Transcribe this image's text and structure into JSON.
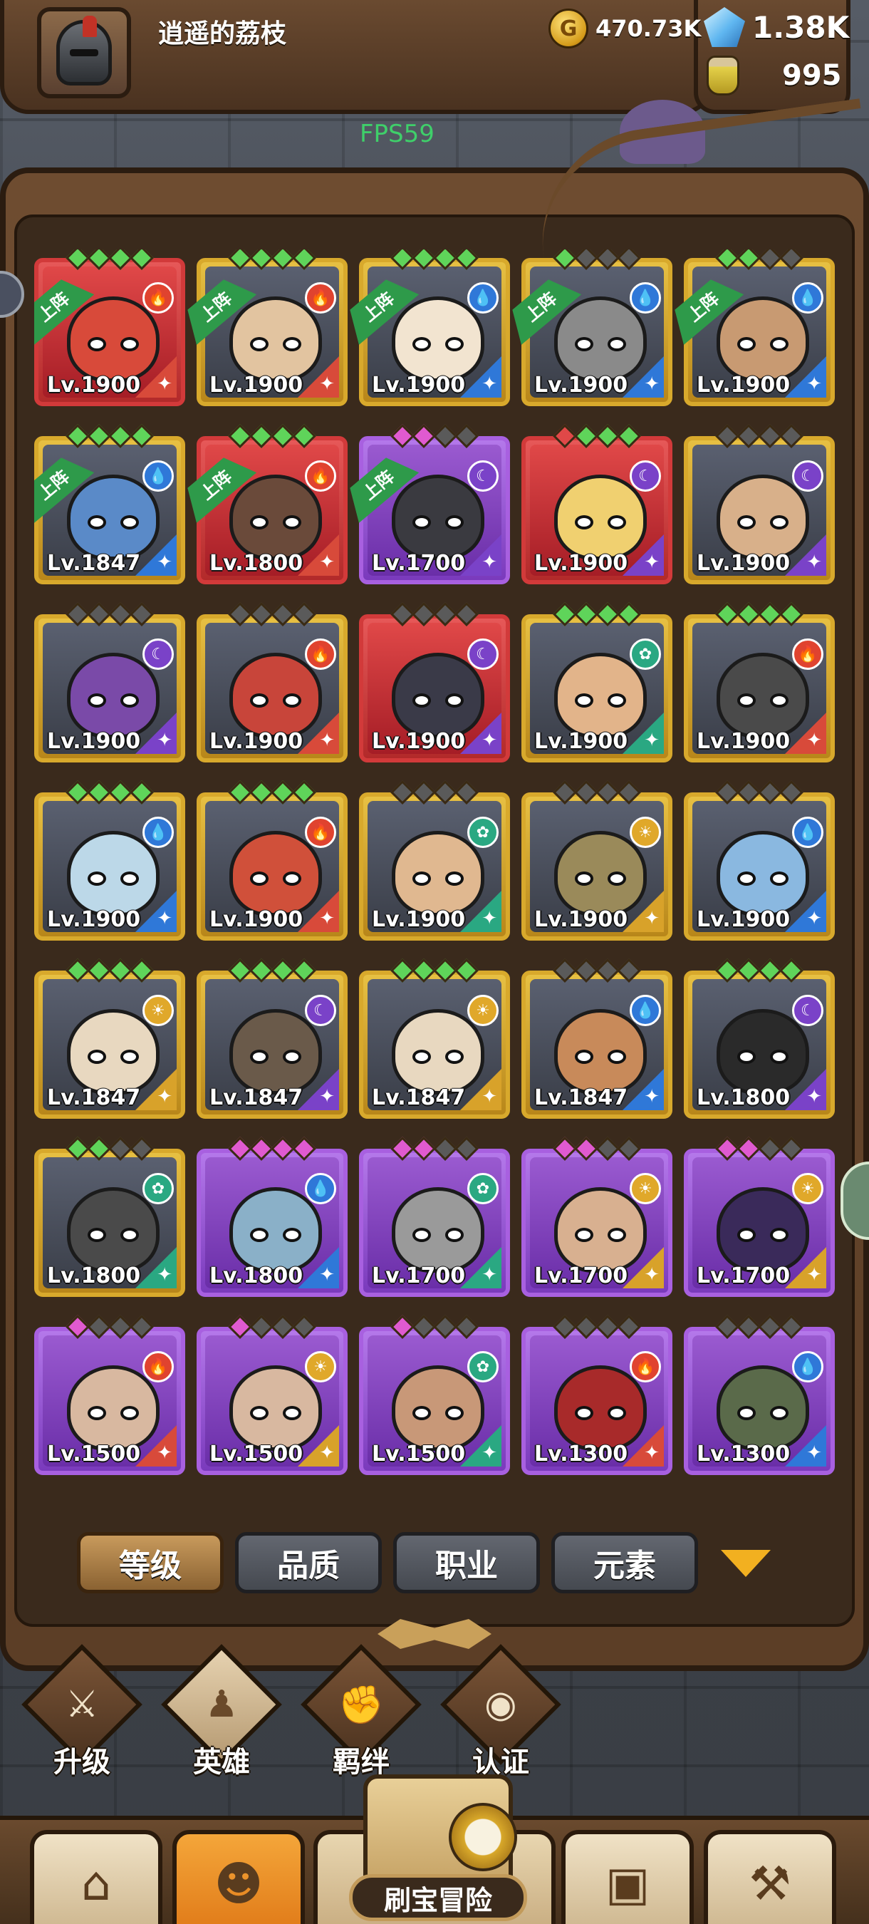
{
  "player": {
    "name": "逍遥的荔枝",
    "gold": "470.73K",
    "gems": "1.38K",
    "potion": "995"
  },
  "fps": "FPS59",
  "onfield_label": "上阵",
  "heroes": [
    {
      "lv": "Lv.1900",
      "onfield": true,
      "element": "fire",
      "rarity": "red",
      "gems": [
        "green",
        "green",
        "green",
        "green"
      ],
      "skin": "#d84a3a"
    },
    {
      "lv": "Lv.1900",
      "onfield": true,
      "element": "fire",
      "rarity": "gold",
      "gems": [
        "green",
        "green",
        "green",
        "green"
      ],
      "skin": "#e2c4a0"
    },
    {
      "lv": "Lv.1900",
      "onfield": true,
      "element": "water",
      "rarity": "gold",
      "gems": [
        "green",
        "green",
        "green",
        "green"
      ],
      "skin": "#f2e4d0"
    },
    {
      "lv": "Lv.1900",
      "onfield": true,
      "element": "water",
      "rarity": "gold",
      "gems": [
        "green",
        "gray",
        "gray",
        "gray"
      ],
      "skin": "#8a8a8a"
    },
    {
      "lv": "Lv.1900",
      "onfield": true,
      "element": "water",
      "rarity": "gold",
      "gems": [
        "green",
        "green",
        "gray",
        "gray"
      ],
      "skin": "#c89a72"
    },
    {
      "lv": "Lv.1847",
      "onfield": true,
      "element": "water",
      "rarity": "gold",
      "gems": [
        "green",
        "green",
        "green",
        "green"
      ],
      "skin": "#5a8ac8"
    },
    {
      "lv": "Lv.1800",
      "onfield": true,
      "element": "fire",
      "rarity": "red",
      "gems": [
        "green",
        "green",
        "green",
        "green"
      ],
      "skin": "#6a4a3a"
    },
    {
      "lv": "Lv.1700",
      "onfield": true,
      "element": "moon",
      "rarity": "purple",
      "gems": [
        "pink",
        "pink",
        "gray",
        "gray"
      ],
      "skin": "#3a3a40"
    },
    {
      "lv": "Lv.1900",
      "onfield": false,
      "element": "moon",
      "rarity": "red",
      "gems": [
        "red",
        "green",
        "green",
        "green"
      ],
      "skin": "#f0d070"
    },
    {
      "lv": "Lv.1900",
      "onfield": false,
      "element": "moon",
      "rarity": "gold",
      "gems": [
        "gray",
        "gray",
        "gray",
        "gray"
      ],
      "skin": "#d8b08a"
    },
    {
      "lv": "Lv.1900",
      "onfield": false,
      "element": "moon",
      "rarity": "gold",
      "gems": [
        "gray",
        "gray",
        "gray",
        "gray"
      ],
      "skin": "#7a4aa8"
    },
    {
      "lv": "Lv.1900",
      "onfield": false,
      "element": "fire",
      "rarity": "gold",
      "gems": [
        "gray",
        "gray",
        "gray",
        "gray"
      ],
      "skin": "#c8453a"
    },
    {
      "lv": "Lv.1900",
      "onfield": false,
      "element": "moon",
      "rarity": "red",
      "gems": [
        "gray",
        "gray",
        "gray",
        "gray"
      ],
      "skin": "#3a3a48"
    },
    {
      "lv": "Lv.1900",
      "onfield": false,
      "element": "wind",
      "rarity": "gold",
      "gems": [
        "green",
        "green",
        "green",
        "green"
      ],
      "skin": "#e2b48a"
    },
    {
      "lv": "Lv.1900",
      "onfield": false,
      "element": "fire",
      "rarity": "gold",
      "gems": [
        "green",
        "green",
        "green",
        "green"
      ],
      "skin": "#4a4a4a"
    },
    {
      "lv": "Lv.1900",
      "onfield": false,
      "element": "water",
      "rarity": "gold",
      "gems": [
        "green",
        "green",
        "green",
        "green"
      ],
      "skin": "#bcd8e8"
    },
    {
      "lv": "Lv.1900",
      "onfield": false,
      "element": "fire",
      "rarity": "gold",
      "gems": [
        "green",
        "green",
        "green",
        "green"
      ],
      "skin": "#d0503a"
    },
    {
      "lv": "Lv.1900",
      "onfield": false,
      "element": "wind",
      "rarity": "gold",
      "gems": [
        "gray",
        "gray",
        "gray",
        "gray"
      ],
      "skin": "#e0b890"
    },
    {
      "lv": "Lv.1900",
      "onfield": false,
      "element": "sun",
      "rarity": "gold",
      "gems": [
        "gray",
        "gray",
        "gray",
        "gray"
      ],
      "skin": "#9a8a5a"
    },
    {
      "lv": "Lv.1900",
      "onfield": false,
      "element": "water",
      "rarity": "gold",
      "gems": [
        "gray",
        "gray",
        "gray",
        "gray"
      ],
      "skin": "#8ab8e0"
    },
    {
      "lv": "Lv.1847",
      "onfield": false,
      "element": "sun",
      "rarity": "gold",
      "gems": [
        "green",
        "green",
        "green",
        "green"
      ],
      "skin": "#e8d8c0"
    },
    {
      "lv": "Lv.1847",
      "onfield": false,
      "element": "moon",
      "rarity": "gold",
      "gems": [
        "green",
        "green",
        "green",
        "green"
      ],
      "skin": "#6a5a4a"
    },
    {
      "lv": "Lv.1847",
      "onfield": false,
      "element": "sun",
      "rarity": "gold",
      "gems": [
        "green",
        "green",
        "green",
        "green"
      ],
      "skin": "#e8d8c0"
    },
    {
      "lv": "Lv.1847",
      "onfield": false,
      "element": "water",
      "rarity": "gold",
      "gems": [
        "gray",
        "gray",
        "gray",
        "gray"
      ],
      "skin": "#c88a5a"
    },
    {
      "lv": "Lv.1800",
      "onfield": false,
      "element": "moon",
      "rarity": "gold",
      "gems": [
        "green",
        "green",
        "green",
        "green"
      ],
      "skin": "#2a2a2a"
    },
    {
      "lv": "Lv.1800",
      "onfield": false,
      "element": "wind",
      "rarity": "gold",
      "gems": [
        "green",
        "green",
        "gray",
        "gray"
      ],
      "skin": "#4a4a4a"
    },
    {
      "lv": "Lv.1800",
      "onfield": false,
      "element": "water",
      "rarity": "purple",
      "gems": [
        "pink",
        "pink",
        "pink",
        "pink"
      ],
      "skin": "#8ab0c8"
    },
    {
      "lv": "Lv.1700",
      "onfield": false,
      "element": "wind",
      "rarity": "purple",
      "gems": [
        "pink",
        "pink",
        "gray",
        "gray"
      ],
      "skin": "#9a9a9a"
    },
    {
      "lv": "Lv.1700",
      "onfield": false,
      "element": "sun",
      "rarity": "purple",
      "gems": [
        "pink",
        "pink",
        "gray",
        "gray"
      ],
      "skin": "#d8b090"
    },
    {
      "lv": "Lv.1700",
      "onfield": false,
      "element": "sun",
      "rarity": "purple",
      "gems": [
        "pink",
        "pink",
        "gray",
        "gray"
      ],
      "skin": "#3a2a5a"
    },
    {
      "lv": "Lv.1500",
      "onfield": false,
      "element": "fire",
      "rarity": "purple",
      "gems": [
        "pink",
        "gray",
        "gray",
        "gray"
      ],
      "skin": "#d8b8a0"
    },
    {
      "lv": "Lv.1500",
      "onfield": false,
      "element": "sun",
      "rarity": "purple",
      "gems": [
        "pink",
        "gray",
        "gray",
        "gray"
      ],
      "skin": "#d8b8a0"
    },
    {
      "lv": "Lv.1500",
      "onfield": false,
      "element": "wind",
      "rarity": "purple",
      "gems": [
        "pink",
        "gray",
        "gray",
        "gray"
      ],
      "skin": "#c89878"
    },
    {
      "lv": "Lv.1300",
      "onfield": false,
      "element": "fire",
      "rarity": "purple",
      "gems": [
        "gray",
        "gray",
        "gray",
        "gray"
      ],
      "skin": "#a82a2a"
    },
    {
      "lv": "Lv.1300",
      "onfield": false,
      "element": "water",
      "rarity": "purple",
      "gems": [
        "gray",
        "gray",
        "gray",
        "gray"
      ],
      "skin": "#5a6a4a"
    }
  ],
  "filters": [
    "等级",
    "品质",
    "职业",
    "元素"
  ],
  "actions": [
    "升级",
    "英雄",
    "羁绊",
    "认证"
  ],
  "adventure_label": "刷宝冒险",
  "icons": {
    "gold": "gold-coin-icon",
    "gems": "diamond-icon",
    "potion": "potion-jar-icon",
    "sort": "triangle-down-icon"
  }
}
